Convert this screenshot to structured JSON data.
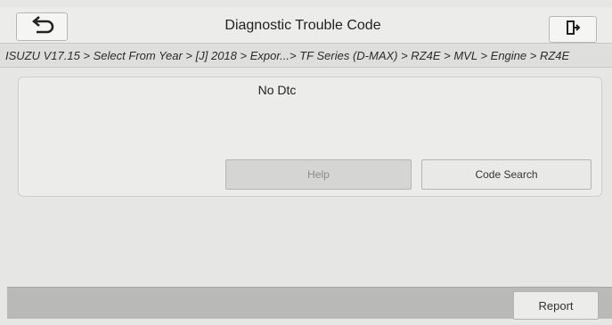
{
  "header": {
    "title": "Diagnostic Trouble Code",
    "back_icon": "back-arrow-icon",
    "exit_icon": "exit-door-icon"
  },
  "breadcrumb": "ISUZU V17.15 > Select From Year > [J] 2018 > Expor...> TF Series (D-MAX) > RZ4E > MVL > Engine > RZ4E",
  "dtc_panel": {
    "message": "No Dtc",
    "help_label": "Help",
    "code_search_label": "Code Search"
  },
  "footer": {
    "report_label": "Report"
  },
  "colors": {
    "background": "#e6e6e4",
    "bottom_bar": "#b9bab7",
    "disabled_button": "#d5d6d3"
  }
}
